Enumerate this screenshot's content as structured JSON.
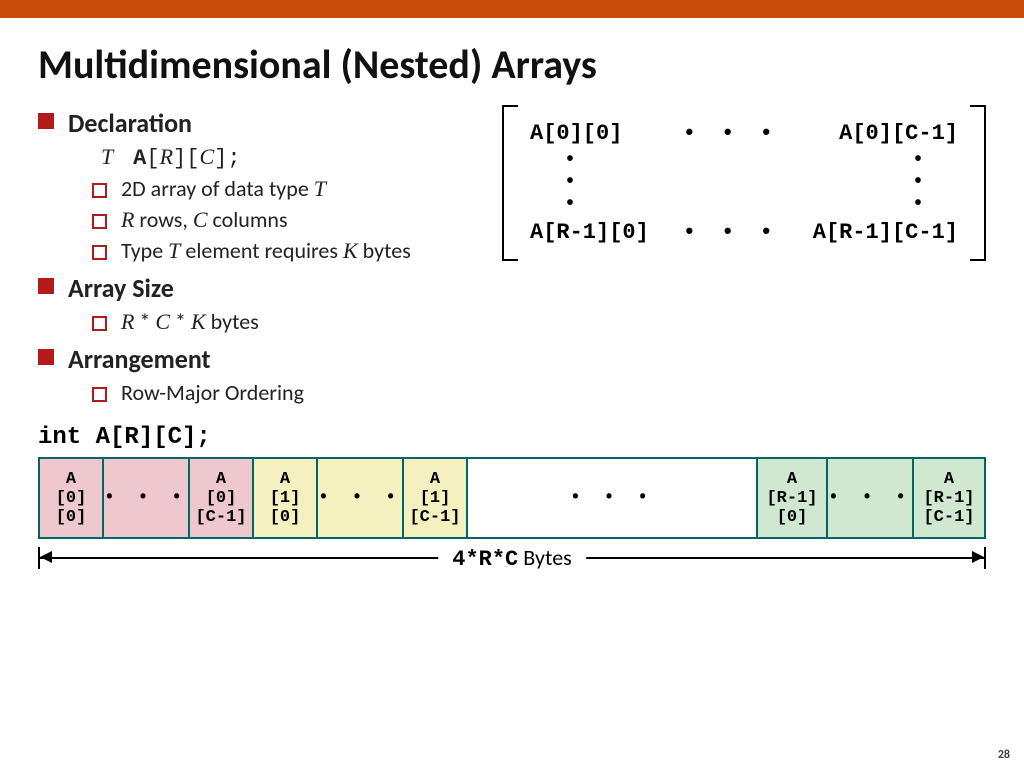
{
  "title": "Multidimensional (Nested) Arrays",
  "sections": {
    "declaration": {
      "heading": "Declaration",
      "code_html": "T  A[R][C];",
      "code_T": "T",
      "code_A": "A",
      "code_R": "R",
      "code_C": "C",
      "code_end": ";",
      "b1_pre": "2D array of data type ",
      "b1_T": "T",
      "b2_R": "R",
      "b2_mid": " rows, ",
      "b2_C": "C",
      "b2_end": " columns",
      "b3_pre": "Type ",
      "b3_T": "T",
      "b3_mid": " element requires ",
      "b3_K": "K",
      "b3_end": " bytes"
    },
    "size": {
      "heading": "Array Size",
      "b1_R": "R",
      "b1_s1": " * ",
      "b1_C": "C",
      "b1_s2": " * ",
      "b1_K": "K",
      "b1_end": " bytes"
    },
    "arrangement": {
      "heading": "Arrangement",
      "b1": "Row-Major Ordering"
    }
  },
  "matrix": {
    "tl": "A[0][0]",
    "tr": "A[0][C-1]",
    "bl": "A[R-1][0]",
    "br": "A[R-1][C-1]",
    "hdots": "• • •"
  },
  "memory": {
    "caption": "int A[R][C];",
    "cells": {
      "a00_A": "A",
      "a00_l2": "[0]",
      "a00_l3": "[0]",
      "a0c_A": "A",
      "a0c_l2": "[0]",
      "a0c_l3": "[C-1]",
      "a10_A": "A",
      "a10_l2": "[1]",
      "a10_l3": "[0]",
      "a1c_A": "A",
      "a1c_l2": "[1]",
      "a1c_l3": "[C-1]",
      "ar0_A": "A",
      "ar0_l2": "[R-1]",
      "ar0_l3": "[0]",
      "arc_A": "A",
      "arc_l2": "[R-1]",
      "arc_l3": "[C-1]",
      "dots": "• • •",
      "bigdots": "•   •   •"
    },
    "measure_code": "4*R*C",
    "measure_word": " Bytes"
  },
  "page": "28"
}
